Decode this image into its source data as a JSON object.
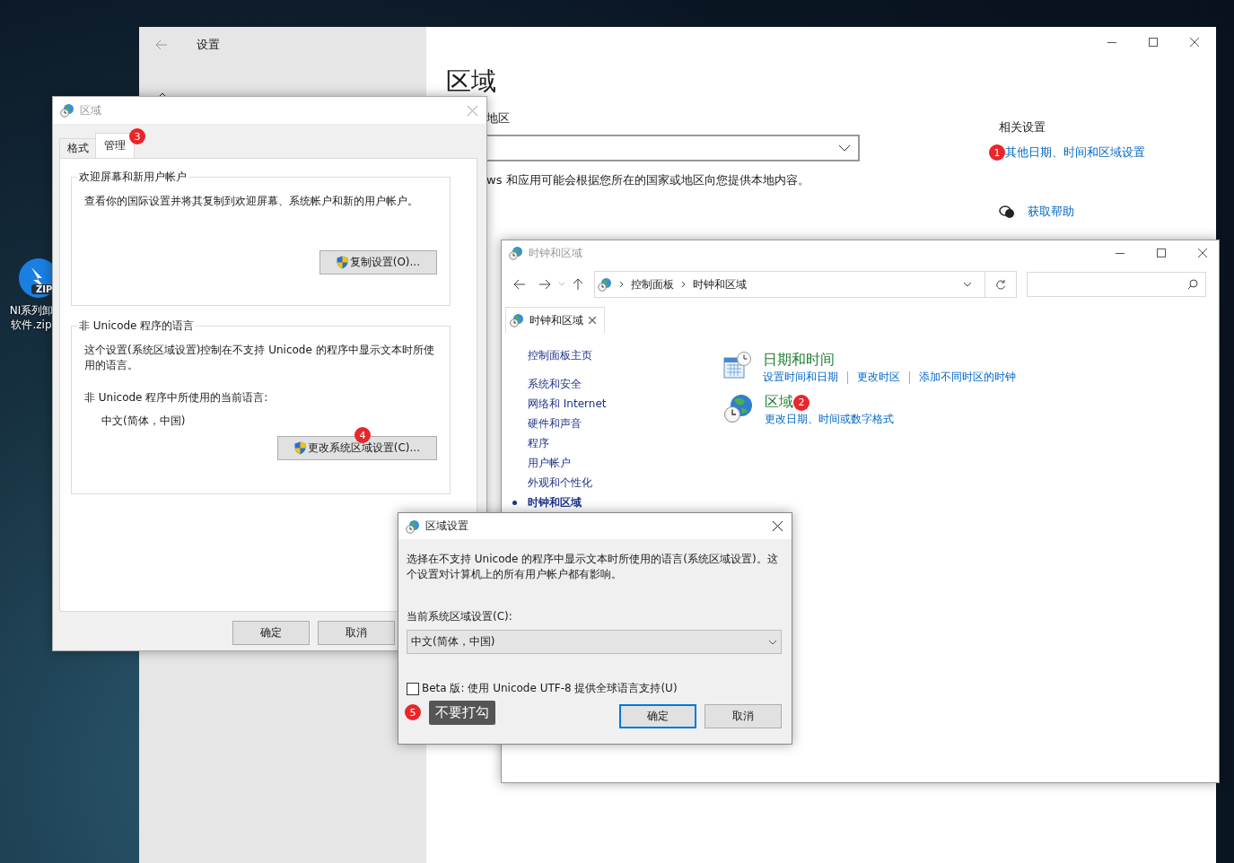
{
  "desktop": {
    "icon": {
      "tag": "ZIP",
      "label_lines": [
        "NI系列卸",
        "软件.zip"
      ]
    }
  },
  "settings_window": {
    "title": "设置",
    "heading": "区域",
    "region_label": "地区",
    "region_note": "ws 和应用可能会根据您所在的国家或地区向您提供本地内容。",
    "related_title": "相关设置",
    "related_link": {
      "text": "其他日期、时间和区域设置",
      "badge": "1"
    },
    "help_link": "获取帮助"
  },
  "region_dialog": {
    "title": "区域",
    "tabs": [
      {
        "label": "格式",
        "selected": false
      },
      {
        "label": "管理",
        "selected": true,
        "badge": "3"
      }
    ],
    "groups": [
      {
        "legend": "欢迎屏幕和新用户帐户",
        "text": "查看你的国际设置并将其复制到欢迎屏幕、系统帐户和新的用户帐户。",
        "button": {
          "label": "复制设置(O)..."
        }
      },
      {
        "legend": "非 Unicode 程序的语言",
        "text": "这个设置(系统区域设置)控制在不支持 Unicode 的程序中显示文本时所使用的语言。",
        "current_label": "非 Unicode 程序中所使用的当前语言:",
        "current_value": "中文(简体，中国)",
        "button": {
          "label": "更改系统区域设置(C)...",
          "badge": "4"
        }
      }
    ],
    "buttons": [
      "确定",
      "取消"
    ]
  },
  "control_panel": {
    "title": "时钟和区域",
    "address": [
      "控制面板",
      "时钟和区域"
    ],
    "tab": "时钟和区域",
    "nav": [
      {
        "label": "控制面板主页",
        "selected": false
      },
      {
        "label": "系统和安全",
        "selected": false
      },
      {
        "label": "网络和 Internet",
        "selected": false
      },
      {
        "label": "硬件和声音",
        "selected": false
      },
      {
        "label": "程序",
        "selected": false
      },
      {
        "label": "用户帐户",
        "selected": false
      },
      {
        "label": "外观和个性化",
        "selected": false
      },
      {
        "label": "时钟和区域",
        "selected": true
      }
    ],
    "categories": [
      {
        "kind": "datetime",
        "title": "日期和时间",
        "links": [
          "设置时间和日期",
          "更改时区",
          "添加不同时区的时钟"
        ]
      },
      {
        "kind": "region",
        "title": "区域",
        "badge": "2",
        "links": [
          "更改日期、时间或数字格式"
        ]
      }
    ]
  },
  "region_settings": {
    "title": "区域设置",
    "description": "选择在不支持 Unicode 的程序中显示文本时所使用的语言(系统区域设置)。这个设置对计算机上的所有用户帐户都有影响。",
    "locale_label": "当前系统区域设置(C):",
    "locale_value": "中文(简体，中国)",
    "beta": {
      "label": "Beta 版: 使用 Unicode UTF-8 提供全球语言支持(U)",
      "checked": false
    },
    "tooltip": {
      "badge": "5",
      "text": "不要打勾"
    },
    "buttons": [
      {
        "label": "确定",
        "default": true
      },
      {
        "label": "取消",
        "default": false
      }
    ]
  }
}
